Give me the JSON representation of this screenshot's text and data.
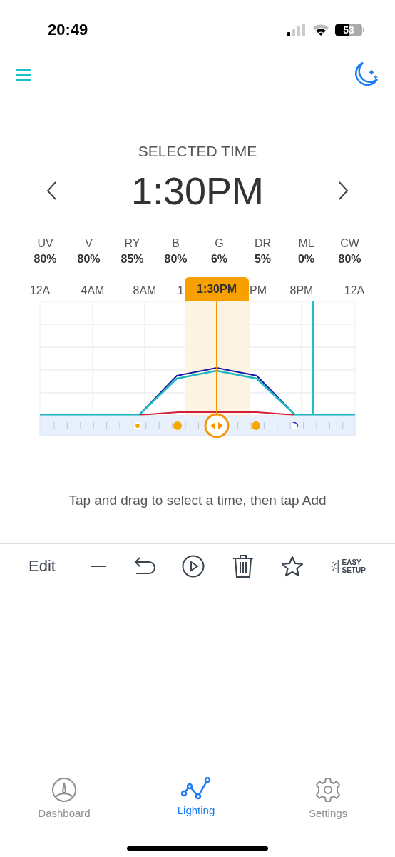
{
  "status_bar": {
    "time": "20:49",
    "battery": "53"
  },
  "selected_time": {
    "label": "SELECTED TIME",
    "value": "1:30PM"
  },
  "channels": [
    {
      "name": "UV",
      "value": "80%"
    },
    {
      "name": "V",
      "value": "80%"
    },
    {
      "name": "RY",
      "value": "85%"
    },
    {
      "name": "B",
      "value": "80%"
    },
    {
      "name": "G",
      "value": "6%"
    },
    {
      "name": "DR",
      "value": "5%"
    },
    {
      "name": "ML",
      "value": "0%"
    },
    {
      "name": "CW",
      "value": "80%"
    }
  ],
  "timeline": {
    "axis_labels": [
      "12A",
      "4AM",
      "8AM",
      "1",
      "PM",
      "8PM",
      "12A"
    ],
    "marker_label": "1:30PM"
  },
  "hint": "Tap and drag to select a time, then tap Add",
  "toolbar": {
    "edit_label": "Edit",
    "easy_setup_label": "EASY SETUP"
  },
  "tabs": [
    {
      "label": "Dashboard",
      "selected": false,
      "kind": "gauge"
    },
    {
      "label": "Lighting",
      "selected": true,
      "kind": "chart"
    },
    {
      "label": "Settings",
      "selected": false,
      "kind": "gear"
    }
  ]
}
